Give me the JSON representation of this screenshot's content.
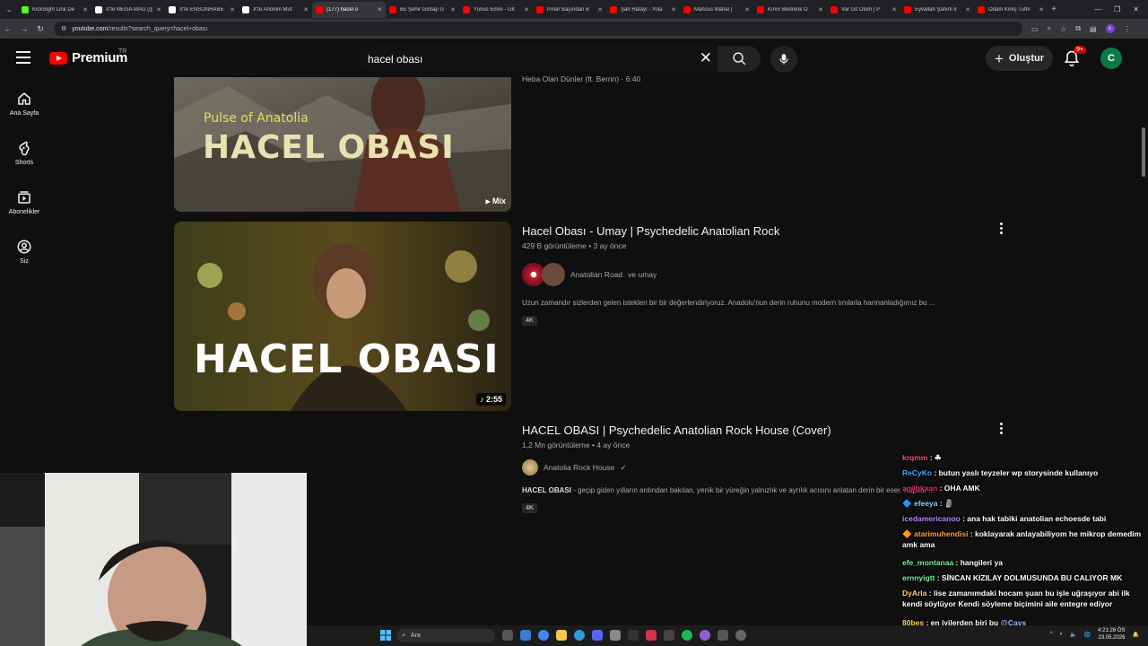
{
  "browser": {
    "tabs": [
      {
        "label": "KickSight Link De",
        "color": "#53fc18"
      },
      {
        "label": "X'te MEGA MAG (@",
        "color": "#ffffff"
      },
      {
        "label": "X'te ENSONHABE",
        "color": "#ffffff"
      },
      {
        "label": "X'te Anonim Mut",
        "color": "#ffffff"
      },
      {
        "label": "(177) hacel o",
        "color": "#ff0000"
      },
      {
        "label": "Bu Şehir Girdap G",
        "color": "#ff0000"
      },
      {
        "label": "Yunus Emre - Git",
        "color": "#ff0000"
      },
      {
        "label": "Pınar Başından B",
        "color": "#ff0000"
      },
      {
        "label": "Şah Hatâyî - Yola",
        "color": "#ff0000"
      },
      {
        "label": "Mahsus Mahal | ",
        "color": "#ff0000"
      },
      {
        "label": "Kırvır Bedrenk O",
        "color": "#ff0000"
      },
      {
        "label": "Var Git Ölüm | P",
        "color": "#ff0000"
      },
      {
        "label": "Eyvallah Şahım 8",
        "color": "#ff0000"
      },
      {
        "label": "Odam Kireç Tutm",
        "color": "#ff0000"
      }
    ],
    "url_host": "youtube.com",
    "url_path": "/results?search_query=hacel+obası"
  },
  "header": {
    "logo_text": "Premium",
    "region": "TR",
    "search_value": "hacel obası",
    "create_label": "Oluştur",
    "notification_count": "9+",
    "avatar_letter": "C"
  },
  "sidebar": {
    "items": [
      {
        "label": "Ana Sayfa",
        "icon": "home-icon"
      },
      {
        "label": "Shorts",
        "icon": "shorts-icon"
      },
      {
        "label": "Abonelikler",
        "icon": "subscriptions-icon"
      },
      {
        "label": "Siz",
        "icon": "you-icon"
      }
    ]
  },
  "results": [
    {
      "thumb_title_small": "Pulse of Anatolia",
      "thumb_title_big": "HACEL OBASI",
      "badge": "Mix",
      "sub": "Heba Olan Dünler (ft. Berrin) · 6:40"
    },
    {
      "title": "Hacel Obası - Umay | Psychedelic Anatolian Rock",
      "views": "429 B görüntüleme",
      "age": "3 ay önce",
      "channel": "Anatolian Road",
      "channel_and": "ve umay",
      "description": "Uzun zamandır sizlerden gelen istekleri bir bir değerlendiriyoruz. Anadolu'nun derin ruhunu modern tınılarla harmanladığımız bu ...",
      "quality": "4K",
      "duration": "2:55",
      "thumb_text": "HACEL OBASI"
    },
    {
      "title": "HACEL OBASI | Psychedelic Anatolian Rock House (Cover)",
      "views": "1,2 Mn görüntüleme",
      "age": "4 ay önce",
      "channel": "Anatolia Rock House",
      "description_bold": "HACEL OBASI",
      "description": " - geçip giden yılların ardından bakılan, yenik bir yüreğin yalnızlık ve ayrılık acısını anlatan derin bir eser. Kapılar ...",
      "quality": "4K"
    }
  ],
  "chat": [
    {
      "user": "krqmm",
      "color": "#ff4d6d",
      "msg": " : ☘"
    },
    {
      "user": "ReCyKo",
      "color": "#4da6ff",
      "msg": " : butun yaslı teyzeler wp storysinde kullanıyo"
    },
    {
      "user": "anilhkaan",
      "color": "#e0306b",
      "msg": " : OHA AMK"
    },
    {
      "user": "efeeya",
      "color": "#7fd6ff",
      "msg": " : 🗿"
    },
    {
      "user": "icedamericanoo",
      "color": "#b28cff",
      "msg": " : ana hak tabiki anatolian echoesde tabi"
    },
    {
      "user": "atarimuhendisi",
      "color": "#ff9f43",
      "msg": " : koklayarak anlayabiliyom he mikrop demedim amk ama"
    },
    {
      "user": "efe_montanaa",
      "color": "#7bed9f",
      "msg": " : hangileri ya"
    },
    {
      "user": "ernnyigtt",
      "color": "#7bed9f",
      "msg": " : SİNCAN KIZILAY DOLMUSUNDA BU CALIYOR MK"
    },
    {
      "user": "DyArla",
      "color": "#ffd166",
      "msg": " : lise zamanımdaki hocam şuan bu işle uğraşıyor abi ilk kendi söylüyor Kendi söyleme biçimini aile entegre ediyor"
    },
    {
      "user": "80bes",
      "color": "#ffd166",
      "msg": " : en iyilerden biri bu ",
      "mention": "@Cavs"
    }
  ],
  "taskbar": {
    "search_label": "Ara",
    "time": "4:21:26 ÖS",
    "date": "23.05.2026"
  }
}
